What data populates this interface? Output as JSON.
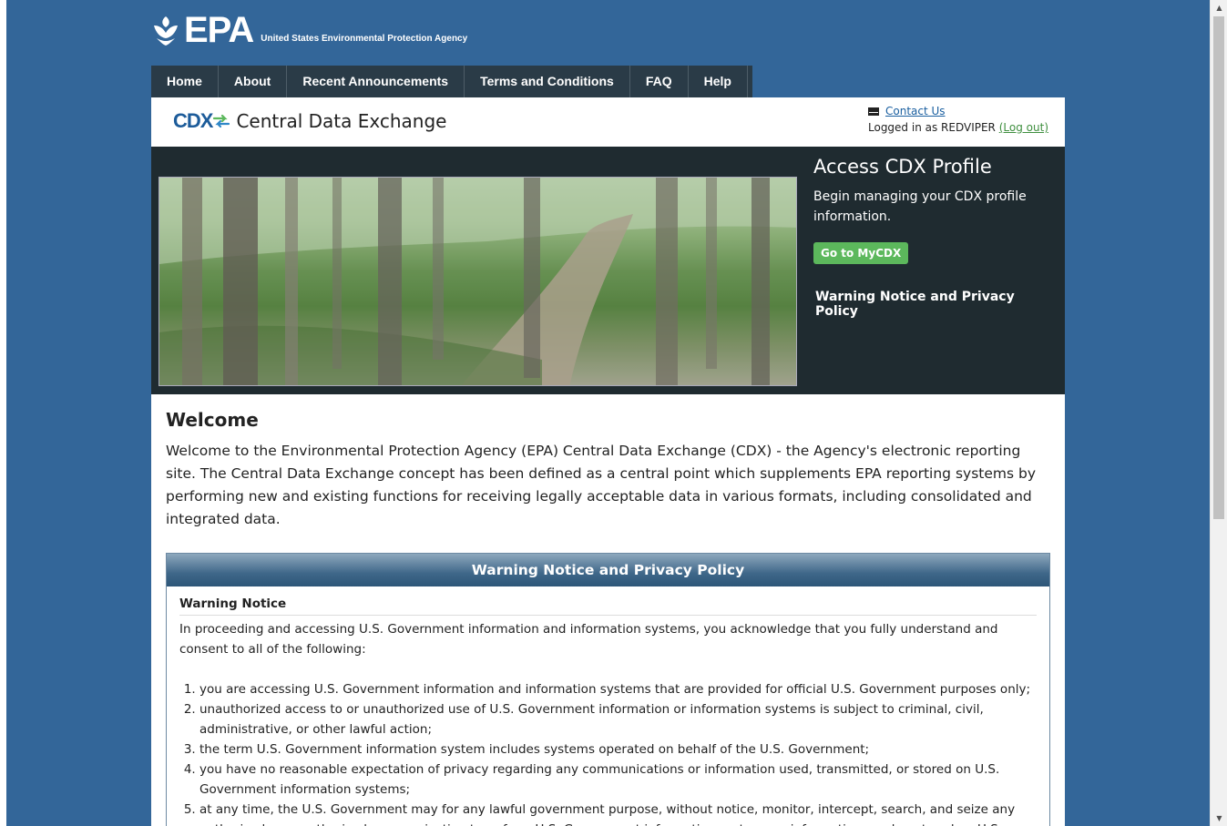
{
  "header": {
    "agency_abbr": "EPA",
    "agency_name": "United States Environmental Protection Agency"
  },
  "nav": {
    "items": [
      "Home",
      "About",
      "Recent Announcements",
      "Terms and Conditions",
      "FAQ",
      "Help"
    ]
  },
  "cdx": {
    "logo_text": "CDX",
    "title": "Central Data Exchange",
    "contact_label": "Contact Us",
    "logged_in_text": "Logged in as REDVIPER",
    "logout_label": "(Log out)"
  },
  "profile": {
    "title": "Access CDX Profile",
    "description": "Begin managing your CDX profile information.",
    "button_label": "Go to MyCDX",
    "warning_link": "Warning Notice and Privacy Policy"
  },
  "welcome": {
    "heading": "Welcome",
    "text": "Welcome to the Environmental Protection Agency (EPA) Central Data Exchange (CDX) - the Agency's electronic reporting site. The Central Data Exchange concept has been defined as a central point which supplements EPA reporting systems by performing new and existing functions for receiving legally acceptable data in various formats, including consolidated and integrated data."
  },
  "warning_panel": {
    "title": "Warning Notice and Privacy Policy",
    "subheading": "Warning Notice",
    "intro": "In proceeding and accessing U.S. Government information and information systems, you acknowledge that you fully understand and consent to all of the following:",
    "items": [
      "you are accessing U.S. Government information and information systems that are provided for official U.S. Government purposes only;",
      "unauthorized access to or unauthorized use of U.S. Government information or information systems is subject to criminal, civil, administrative, or other lawful action;",
      "the term U.S. Government information system includes systems operated on behalf of the U.S. Government;",
      "you have no reasonable expectation of privacy regarding any communications or information used, transmitted, or stored on U.S. Government information systems;",
      "at any time, the U.S. Government may for any lawful government purpose, without notice, monitor, intercept, search, and seize any authorized or unauthorized communication to or from U.S. Government information systems or information used or stored on U.S. Government information systems;"
    ]
  },
  "colors": {
    "page_bg": "#336699",
    "nav_bg": "#2a3b47",
    "hero_bg": "#1f2b30",
    "button_green": "#5cb85c",
    "link_blue": "#1a5fa0"
  }
}
